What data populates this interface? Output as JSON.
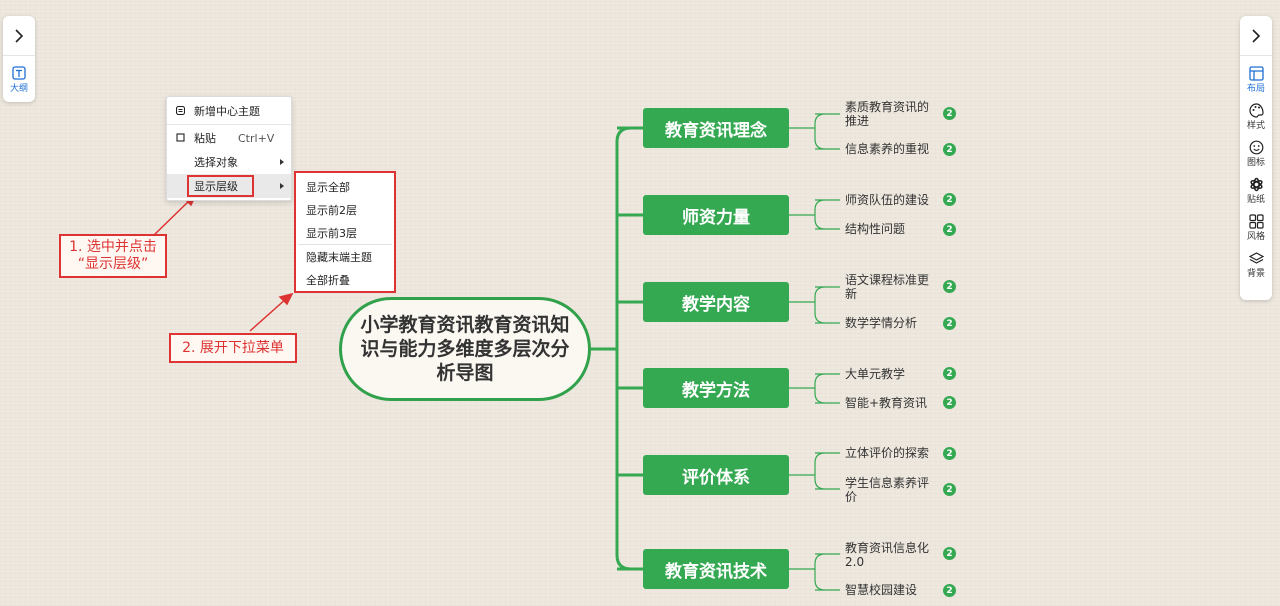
{
  "left_panel": {
    "outline_label": "大纲"
  },
  "right_panel": {
    "tools": [
      {
        "label": "布局",
        "icon": "layout-icon"
      },
      {
        "label": "样式",
        "icon": "palette-icon"
      },
      {
        "label": "图标",
        "icon": "smiley-icon"
      },
      {
        "label": "贴纸",
        "icon": "sticker-icon"
      },
      {
        "label": "风格",
        "icon": "grid-style-icon"
      },
      {
        "label": "背景",
        "icon": "layers-icon"
      }
    ]
  },
  "context_menu": {
    "new_central_topic": "新增中心主题",
    "paste": "粘贴",
    "paste_shortcut": "Ctrl+V",
    "select_objects": "选择对象",
    "show_levels": "显示层级"
  },
  "submenu": {
    "items": [
      "显示全部",
      "显示前2层",
      "显示前3层",
      "隐藏末端主题",
      "全部折叠"
    ]
  },
  "annotations": {
    "step1_line1": "1. 选中并点击",
    "step1_line2": "“显示层级”",
    "step2": "2. 展开下拉菜单"
  },
  "mindmap": {
    "center": "小学教育资讯教育资讯知识与能力多维度多层次分析导图",
    "branches": [
      {
        "title": "教育资讯理念",
        "leaves": [
          "素质教育资讯的推进",
          "信息素养的重视"
        ]
      },
      {
        "title": "师资力量",
        "leaves": [
          "师资队伍的建设",
          "结构性问题"
        ]
      },
      {
        "title": "教学内容",
        "leaves": [
          "语文课程标准更新",
          "数学学情分析"
        ]
      },
      {
        "title": "教学方法",
        "leaves": [
          "大单元教学",
          "智能+教育资讯"
        ]
      },
      {
        "title": "评价体系",
        "leaves": [
          "立体评价的探索",
          "学生信息素养评价"
        ]
      },
      {
        "title": "教育资讯技术",
        "leaves": [
          "教育资讯信息化2.0",
          "智慧校园建设"
        ]
      }
    ],
    "badge": "2"
  },
  "colors": {
    "accent": "#35a852",
    "annotation": "#dd3333",
    "active": "#1f6fd6"
  }
}
